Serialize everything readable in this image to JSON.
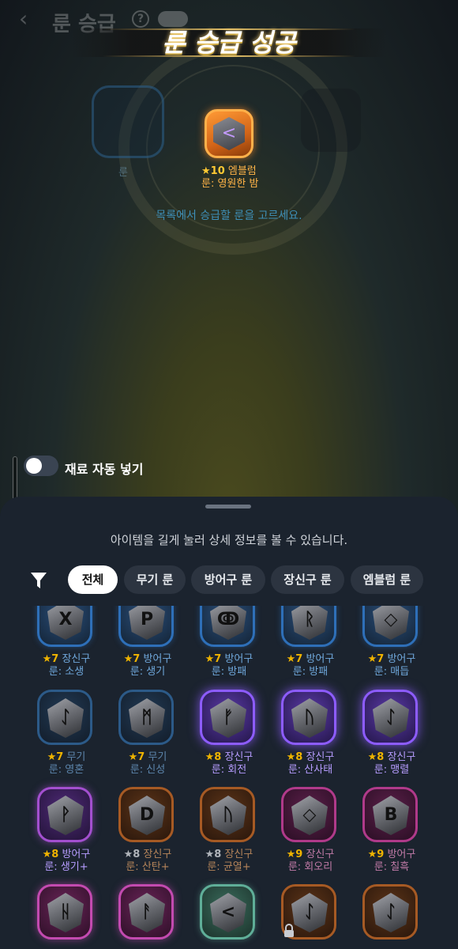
{
  "header": {
    "title": "룬 승급",
    "help_icon": "question-circle-icon",
    "back_icon": "chevron-left-icon"
  },
  "banner": {
    "text": "룬 승급 성공"
  },
  "slots": {
    "left_label": "룬"
  },
  "result": {
    "star": "★10",
    "name": "엠블럼",
    "rune_line": "룬: 영원한 밤"
  },
  "instruction": "목록에서 승급할 룬을 고르세요.",
  "auto_fill": {
    "label": "재료 자동 넣기",
    "enabled": false
  },
  "sheet": {
    "hint": "아이템을 길게 눌러 상세 정보를 볼 수 있습니다.",
    "filter_icon": "filter-icon",
    "tabs": [
      "전체",
      "무기 룬",
      "방어구 룬",
      "장신구 룬",
      "엠블럼 룬"
    ],
    "active_tab": 0
  },
  "items": [
    {
      "star": "★7",
      "type": "장신구",
      "rune": "룬: 소생"
    },
    {
      "star": "★7",
      "type": "방어구",
      "rune": "룬: 생기"
    },
    {
      "star": "★7",
      "type": "방어구",
      "rune": "룬: 방패"
    },
    {
      "star": "★7",
      "type": "방어구",
      "rune": "룬: 방패"
    },
    {
      "star": "★7",
      "type": "방어구",
      "rune": "룬: 매듭"
    },
    {
      "star": "★7",
      "type": "무기",
      "rune": "룬: 영혼"
    },
    {
      "star": "★7",
      "type": "무기",
      "rune": "룬: 신성"
    },
    {
      "star": "★8",
      "type": "장신구",
      "rune": "룬: 회전"
    },
    {
      "star": "★8",
      "type": "장신구",
      "rune": "룬: 산사태"
    },
    {
      "star": "★8",
      "type": "장신구",
      "rune": "룬: 맹렬"
    },
    {
      "star": "★8",
      "type": "방어구",
      "rune": "룬: 생기+"
    },
    {
      "star": "★8",
      "type": "장신구",
      "rune": "룬: 산탄+"
    },
    {
      "star": "★8",
      "type": "장신구",
      "rune": "룬: 균열+"
    },
    {
      "star": "★9",
      "type": "장신구",
      "rune": "룬: 회오리"
    },
    {
      "star": "★9",
      "type": "방어구",
      "rune": "룬: 칠흑"
    }
  ]
}
